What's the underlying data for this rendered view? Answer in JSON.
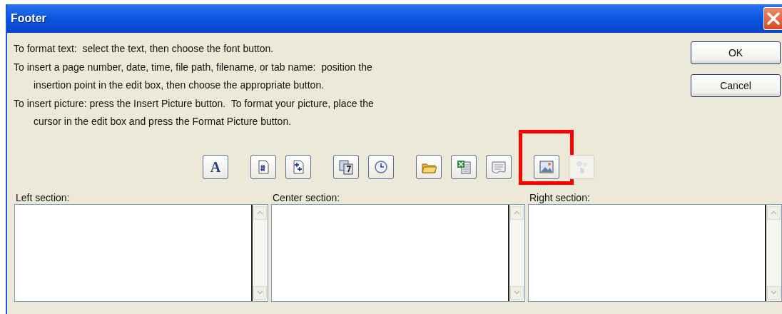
{
  "window": {
    "title": "Footer"
  },
  "instructions": [
    {
      "lines": [
        "To format text:  select the text, then choose the font button."
      ]
    },
    {
      "lines": [
        "To insert a page number, date, time, file path, filename, or tab name:  position the",
        "insertion point in the edit box, then choose the appropriate button."
      ]
    },
    {
      "lines": [
        "To insert picture: press the Insert Picture button.  To format your picture, place the",
        "cursor in the edit box and press the Format Picture button."
      ]
    }
  ],
  "buttons": [
    "OK",
    "Cancel"
  ],
  "toolbar": [
    {
      "kind": "font",
      "glyph": "A",
      "group_start": true,
      "disabled": false,
      "highlighted": false
    },
    {
      "kind": "page-number",
      "group_start": true,
      "disabled": false,
      "highlighted": false
    },
    {
      "kind": "page-count",
      "group_start": false,
      "disabled": false,
      "highlighted": false
    },
    {
      "kind": "date",
      "group_start": true,
      "disabled": false,
      "highlighted": false
    },
    {
      "kind": "time",
      "group_start": false,
      "disabled": false,
      "highlighted": false
    },
    {
      "kind": "file-path",
      "group_start": true,
      "disabled": false,
      "highlighted": false
    },
    {
      "kind": "filename",
      "group_start": false,
      "disabled": false,
      "highlighted": false
    },
    {
      "kind": "sheet-name",
      "group_start": false,
      "disabled": false,
      "highlighted": false
    },
    {
      "kind": "picture",
      "group_start": true,
      "disabled": false,
      "highlighted": true
    },
    {
      "kind": "format-picture",
      "group_start": false,
      "disabled": true,
      "highlighted": false
    }
  ],
  "sections": [
    {
      "label": "Left section:"
    },
    {
      "label": "Center section:"
    },
    {
      "label": "Right section:"
    }
  ]
}
